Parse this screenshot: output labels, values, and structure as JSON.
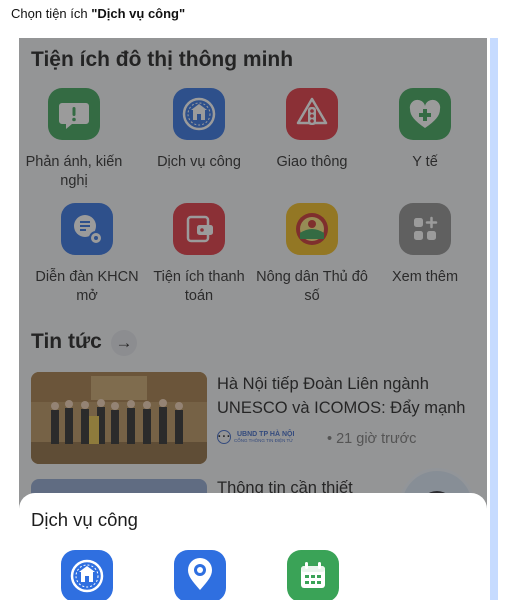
{
  "instruction": {
    "prefix": "Chọn tiện ích ",
    "target": "\"Dịch vụ công\""
  },
  "utilities": {
    "title": "Tiện ích đô thị thông minh",
    "items": [
      {
        "label": "Phản ánh, kiến nghị",
        "icon": "report-bubble-icon",
        "color": "#3aa357"
      },
      {
        "label": "Dịch vụ công",
        "icon": "ha-noi-emblem-icon",
        "color": "#2f6fe0"
      },
      {
        "label": "Giao thông",
        "icon": "traffic-light-icon",
        "color": "#e0333f"
      },
      {
        "label": "Y tế",
        "icon": "health-heart-icon",
        "color": "#3aa357"
      },
      {
        "label": "Diễn đàn KHCN mở",
        "icon": "science-forum-icon",
        "color": "#2f6fe0"
      },
      {
        "label": "Tiện ích thanh toán",
        "icon": "wallet-icon",
        "color": "#e0333f"
      },
      {
        "label": "Nông dân Thủ đô số",
        "icon": "farmer-emblem-icon",
        "color": "#f0ba1c"
      },
      {
        "label": "Xem thêm",
        "icon": "grid-more-icon",
        "color": "#8f8f8f"
      }
    ]
  },
  "news": {
    "title": "Tin tức",
    "items": [
      {
        "title": "Hà Nội tiếp Đoàn Liên ngành UNESCO và ICOMOS: Đẩy mạnh ...",
        "source_name": "UBND TP HÀ NỘI",
        "source_sub": "CỔNG THÔNG TIN ĐIỆN TỬ",
        "time": "21 giờ trước"
      },
      {
        "title": "Thông tin cần thiết"
      }
    ]
  },
  "sheet": {
    "title": "Dịch vụ công",
    "icons": [
      "ha-noi-emblem-icon",
      "location-pin-icon",
      "calendar-icon"
    ]
  },
  "colors": {
    "accent_blue": "#2f6fe0",
    "green": "#3aa357",
    "red": "#e0333f",
    "gold": "#f0ba1c"
  }
}
